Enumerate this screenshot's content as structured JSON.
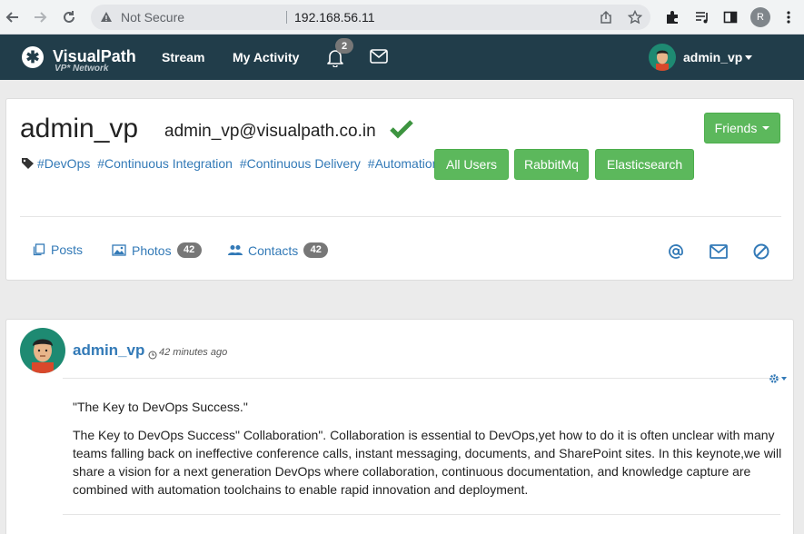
{
  "browser": {
    "security_label": "Not Secure",
    "url": "192.168.56.11",
    "profile_initial": "R"
  },
  "navbar": {
    "brand_name": "VisualPath",
    "brand_sub": "VP* Network",
    "stream_label": "Stream",
    "activity_label": "My Activity",
    "notification_count": "2",
    "user_name": "admin_vp"
  },
  "profile": {
    "name": "admin_vp",
    "email": "admin_vp@visualpath.co.in",
    "friends_label": "Friends",
    "tags": [
      "#DevOps",
      "#Continuous Integration",
      "#Continuous Delivery",
      "#Automation"
    ],
    "groups": [
      "All Users",
      "RabbitMq",
      "Elasticsearch"
    ],
    "tabs": {
      "posts_label": "Posts",
      "photos_label": "Photos",
      "photos_count": "42",
      "contacts_label": "Contacts",
      "contacts_count": "42"
    }
  },
  "post": {
    "author": "admin_vp",
    "time": "42 minutes ago",
    "title": "\"The Key to DevOps Success.\"",
    "body": "The Key to DevOps Success\" Collaboration\". Collaboration is essential to DevOps,yet how to do it is often unclear with many teams falling back on ineffective conference calls, instant messaging, documents, and SharePoint sites. In this keynote,we will share a vision for a next generation DevOps where collaboration, continuous documentation, and knowledge capture are combined with automation toolchains to enable rapid innovation and deployment."
  },
  "colors": {
    "navbar": "#213d4a",
    "link": "#337ab7",
    "success": "#5cb85c",
    "badge": "#777777"
  }
}
